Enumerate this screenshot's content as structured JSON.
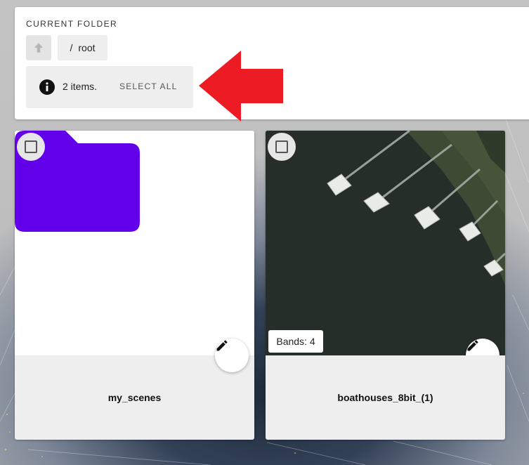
{
  "folder_panel": {
    "title": "CURRENT FOLDER",
    "breadcrumb": {
      "separator": "/",
      "name": "root"
    },
    "info": {
      "count_text": "2 items.",
      "select_all_label": "SELECT ALL"
    }
  },
  "items": [
    {
      "name": "my_scenes",
      "type": "folder",
      "folder_color": "#6200ea"
    },
    {
      "name": "boathouses_8bit_(1)",
      "type": "image",
      "bands_label": "Bands: 4"
    }
  ],
  "colors": {
    "annotation_arrow": "#ed1c24"
  },
  "icons": {
    "up": "arrow-up-icon",
    "info": "info-icon",
    "checkbox": "checkbox-blank-icon",
    "edit": "pencil-icon",
    "folder": "folder-icon"
  }
}
